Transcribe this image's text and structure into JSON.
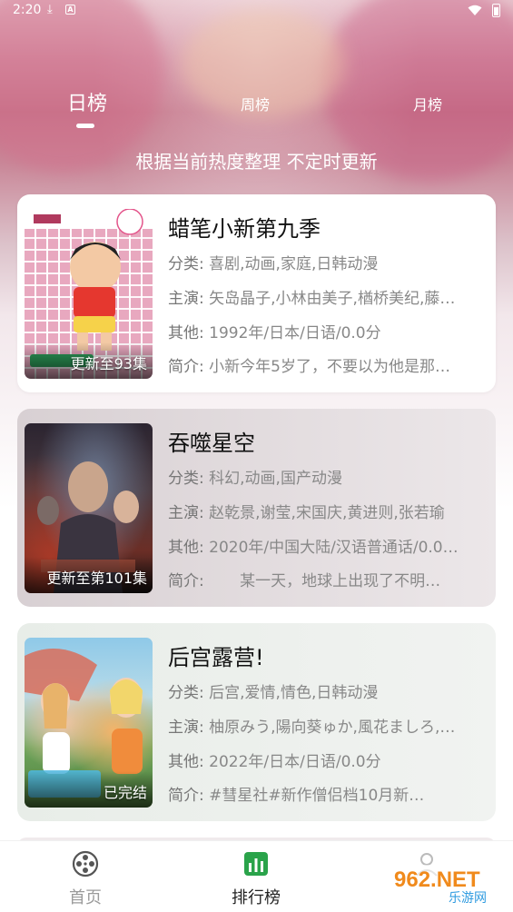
{
  "status_bar": {
    "time": "2:20"
  },
  "tabs": [
    {
      "label": "日榜",
      "active": true
    },
    {
      "label": "周榜",
      "active": false
    },
    {
      "label": "月榜",
      "active": false
    }
  ],
  "subtitle": "根据当前热度整理 不定时更新",
  "cards": [
    {
      "title": "蜡笔小新第九季",
      "badge": "更新至93集",
      "genre_key": "分类:",
      "genre": "喜剧,动画,家庭,日韩动漫",
      "cast_key": "主演:",
      "cast": "矢岛晶子,小林由美子,楢桥美纪,藤…",
      "other_key": "其他:",
      "other": "1992年/日本/日语/0.0分",
      "intro_key": "简介:",
      "intro": "小新今年5岁了，不要以为他是那…"
    },
    {
      "title": "吞噬星空",
      "badge": "更新至第101集",
      "genre_key": "分类:",
      "genre": "科幻,动画,国产动漫",
      "cast_key": "主演:",
      "cast": "赵乾景,谢莹,宋国庆,黄进则,张若瑜",
      "other_key": "其他:",
      "other": "2020年/中国大陆/汉语普通话/0.0…",
      "intro_key": "简介:",
      "intro": "　　某一天，地球上出现了不明…"
    },
    {
      "title": "后宫露营!",
      "badge": "已完结",
      "genre_key": "分类:",
      "genre": "后宫,爱情,情色,日韩动漫",
      "cast_key": "主演:",
      "cast": "柚原みう,陽向葵ゅか,風花ましろ,…",
      "other_key": "其他:",
      "other": "2022年/日本/日语/0.0分",
      "intro_key": "简介:",
      "intro": "#彗星社#新作僧侣档10月新…"
    }
  ],
  "bottom_nav": [
    {
      "label": "首页",
      "icon": "film-reel-icon",
      "active": false
    },
    {
      "label": "排行榜",
      "icon": "bar-chart-icon",
      "active": true
    },
    {
      "label": "",
      "icon": "profile-icon",
      "active": false
    }
  ],
  "watermark": {
    "main": "962.NET",
    "sub": "乐游网"
  },
  "colors": {
    "accent_green": "#2aa34a",
    "text_dark": "#111111",
    "text_grey": "#777777"
  }
}
